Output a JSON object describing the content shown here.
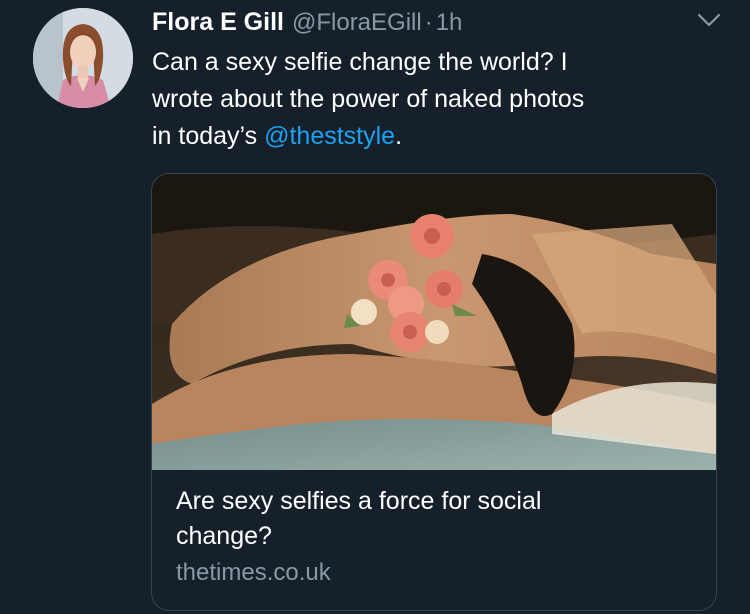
{
  "tweet": {
    "author_name": "Flora E Gill",
    "author_handle": "@FloraEGill",
    "separator": "·",
    "timestamp": "1h",
    "text_lines": [
      "Can a sexy selfie change the world? I",
      "wrote about the power of naked photos"
    ],
    "text_last_prefix": "in today’s ",
    "mention": "@theststyle",
    "text_last_suffix": "."
  },
  "card": {
    "title": "Are sexy selfies a force for social change?",
    "domain": "thetimes.co.uk"
  },
  "icons": {
    "menu": "chevron-down-icon",
    "avatar": "avatar"
  },
  "colors": {
    "background": "#15202b",
    "link": "#1da1f2",
    "secondary_text": "#8899a6",
    "card_border": "#38444d"
  }
}
